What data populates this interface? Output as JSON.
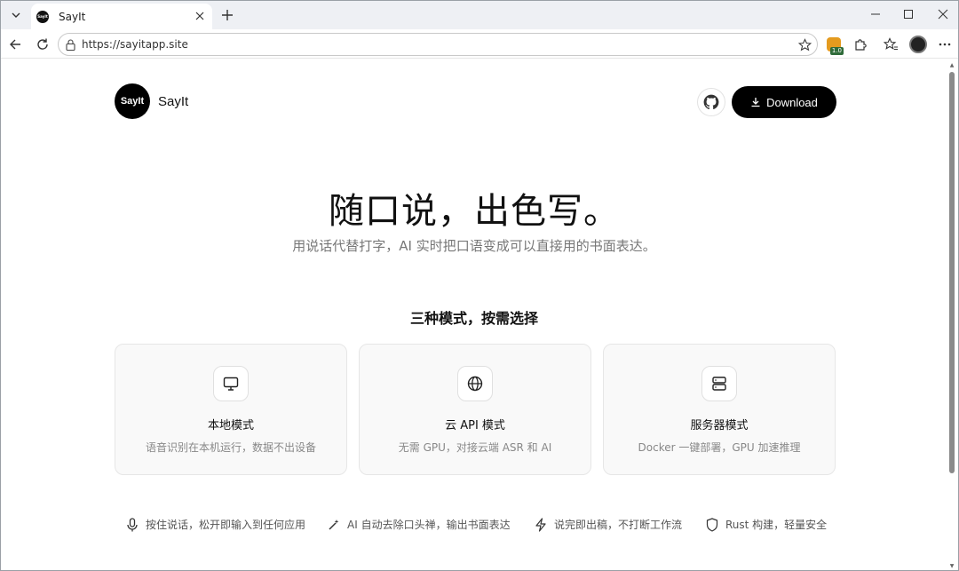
{
  "browser": {
    "tab": {
      "title": "SayIt",
      "favicon_text": "SayIt"
    },
    "url": "https://sayitapp.site",
    "extension_badge": "1.0"
  },
  "site": {
    "brand": {
      "logo_text": "SayIt",
      "name": "SayIt"
    },
    "nav": {
      "download_label": "Download"
    },
    "hero": {
      "title": "随口说，出色写。",
      "subtitle": "用说话代替打字，AI 实时把口语变成可以直接用的书面表达。"
    },
    "modes": {
      "section_title": "三种模式，按需选择",
      "cards": [
        {
          "icon": "monitor-icon",
          "title": "本地模式",
          "desc": "语音识别在本机运行，数据不出设备"
        },
        {
          "icon": "globe-icon",
          "title": "云 API 模式",
          "desc": "无需 GPU，对接云端 ASR 和 AI"
        },
        {
          "icon": "server-icon",
          "title": "服务器模式",
          "desc": "Docker 一键部署，GPU 加速推理"
        }
      ]
    },
    "features": [
      {
        "icon": "microphone-icon",
        "text": "按住说话，松开即输入到任何应用"
      },
      {
        "icon": "magic-wand-icon",
        "text": "AI 自动去除口头禅，输出书面表达"
      },
      {
        "icon": "lightning-icon",
        "text": "说完即出稿，不打断工作流"
      },
      {
        "icon": "shield-icon",
        "text": "Rust 构建，轻量安全"
      }
    ]
  }
}
